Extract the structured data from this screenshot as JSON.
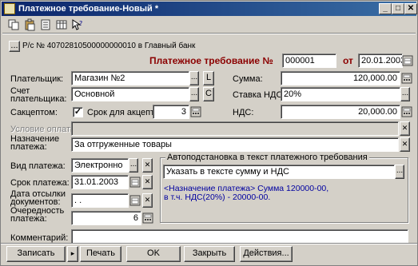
{
  "window": {
    "title": "Платежное требование-Новый *"
  },
  "toolbar": {
    "icons": [
      "copy-icon",
      "paste-icon",
      "document-icon",
      "table-icon",
      "help-arrow-icon"
    ]
  },
  "account": {
    "text": "Р/с № 40702810500000000010 в Главный банк"
  },
  "doc": {
    "title": "Платежное требование №",
    "number": "000001",
    "date_label": "от",
    "date": "20.01.2003"
  },
  "form": {
    "payer_label": "Плательщик:",
    "payer_value": "Магазин №2",
    "payer_btn": "L",
    "account_label": "Счет плательщика:",
    "account_value": "Основной",
    "account_btn": "C",
    "acceptance_label": "Сакцептом:",
    "acceptance_checked": "✓",
    "acceptance_term_label": "Срок для акцепта:",
    "acceptance_term_value": "3",
    "payment_terms_label": "Условие оплаты:",
    "purpose_label": "Назначение платежа:",
    "purpose_value": "За отгруженные товары",
    "sum_label": "Сумма:",
    "sum_value": "120,000.00",
    "vat_rate_label": "Ставка НДС:",
    "vat_rate_value": "20%",
    "vat_label": "НДС:",
    "vat_value": "20,000.00",
    "pay_type_label": "Вид платежа:",
    "pay_type_value": "Электронно",
    "pay_term_label": "Срок платежа:",
    "pay_term_value": "31.01.2003",
    "shipping_date_label": "Дата отсылки документов:",
    "shipping_date_value": ".  .",
    "priority_label": "Очередность платежа:",
    "priority_value": "6",
    "comment_label": "Комментарий:"
  },
  "autofill": {
    "group_title": "Автоподстановка в текст платежного требования",
    "select_value": "Указать в тексте сумму и НДС",
    "info_line1": "<Назначение платежа> Сумма 120000-00,",
    "info_line2": "в т.ч. НДС(20%) - 20000-00."
  },
  "buttons": {
    "save": "Записать",
    "print": "Печать",
    "ok": "OK",
    "close": "Закрыть",
    "actions": "Действия..."
  },
  "icons": {
    "x": "✕",
    "ellipsis": "...",
    "arrow": "▸"
  }
}
